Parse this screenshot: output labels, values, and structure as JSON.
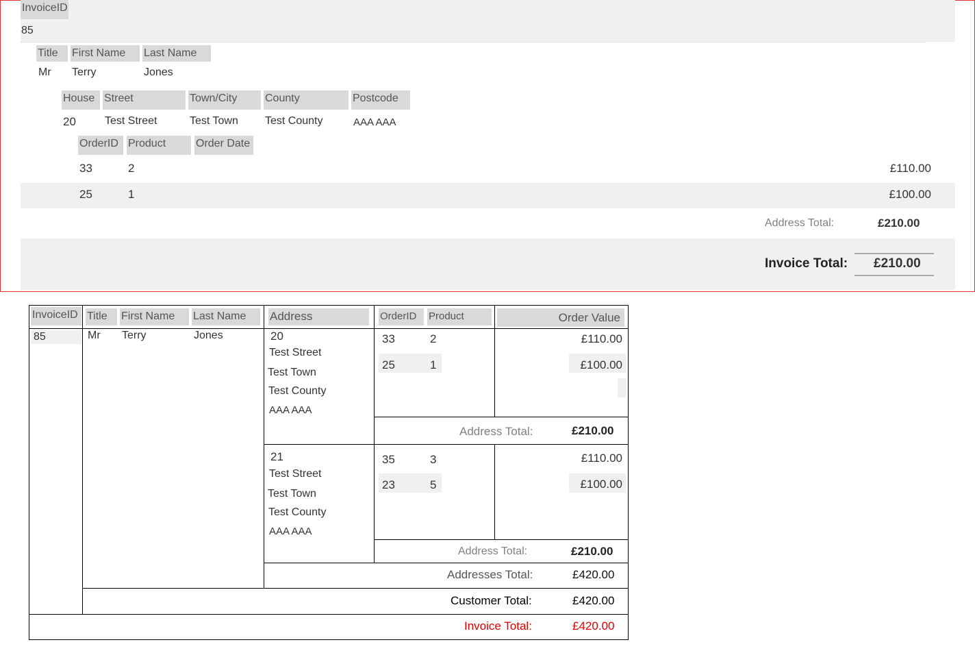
{
  "top_report": {
    "invoice_id_label": "InvoiceID",
    "invoice_id": "85",
    "customer_headers": {
      "title": "Title",
      "first_name": "First Name",
      "last_name": "Last Name"
    },
    "customer": {
      "title": "Mr",
      "first_name": "Terry",
      "last_name": "Jones"
    },
    "address_headers": {
      "house": "House",
      "street": "Street",
      "town": "Town/City",
      "county": "County",
      "postcode": "Postcode"
    },
    "address": {
      "house": "20",
      "street": "Test Street",
      "town": "Test Town",
      "county": "Test County",
      "postcode": "AAA AAA"
    },
    "order_headers": {
      "order_id": "OrderID",
      "product": "Product",
      "order_date": "Order Date"
    },
    "orders": [
      {
        "order_id": "33",
        "product": "2",
        "value": "£110.00"
      },
      {
        "order_id": "25",
        "product": "1",
        "value": "£100.00"
      }
    ],
    "address_total_label": "Address Total:",
    "address_total": "£210.00",
    "invoice_total_label": "Invoice Total:",
    "invoice_total": "£210.00"
  },
  "bottom_report": {
    "headers": {
      "invoice_id": "InvoiceID",
      "title": "Title",
      "first_name": "First Name",
      "last_name": "Last Name",
      "address": "Address",
      "order_id": "OrderID",
      "product": "Product",
      "order_value": "Order Value"
    },
    "invoice_id": "85",
    "customer": {
      "title": "Mr",
      "first_name": "Terry",
      "last_name": "Jones"
    },
    "addresses": [
      {
        "house": "20",
        "street": "Test Street",
        "town": "Test Town",
        "county": "Test County",
        "postcode": "AAA AAA",
        "orders": [
          {
            "order_id": "33",
            "product": "2",
            "value": "£110.00"
          },
          {
            "order_id": "25",
            "product": "1",
            "value": "£100.00"
          }
        ],
        "total_label": "Address Total:",
        "total": "£210.00"
      },
      {
        "house": "21",
        "street": "Test Street",
        "town": "Test Town",
        "county": "Test County",
        "postcode": "AAA AAA",
        "orders": [
          {
            "order_id": "35",
            "product": "3",
            "value": "£110.00"
          },
          {
            "order_id": "23",
            "product": "5",
            "value": "£100.00"
          }
        ],
        "total_label": "Address Total:",
        "total": "£210.00"
      }
    ],
    "addresses_total_label": "Addresses Total:",
    "addresses_total": "£420.00",
    "customer_total_label": "Customer Total:",
    "customer_total": "£420.00",
    "invoice_total_label": "Invoice Total:",
    "invoice_total": "£420.00"
  },
  "colors": {
    "frame_border": "#e03030",
    "header_bg": "#d9d9d9",
    "band_bg": "#f0f0f0",
    "invoice_total_red": "#e00000"
  }
}
